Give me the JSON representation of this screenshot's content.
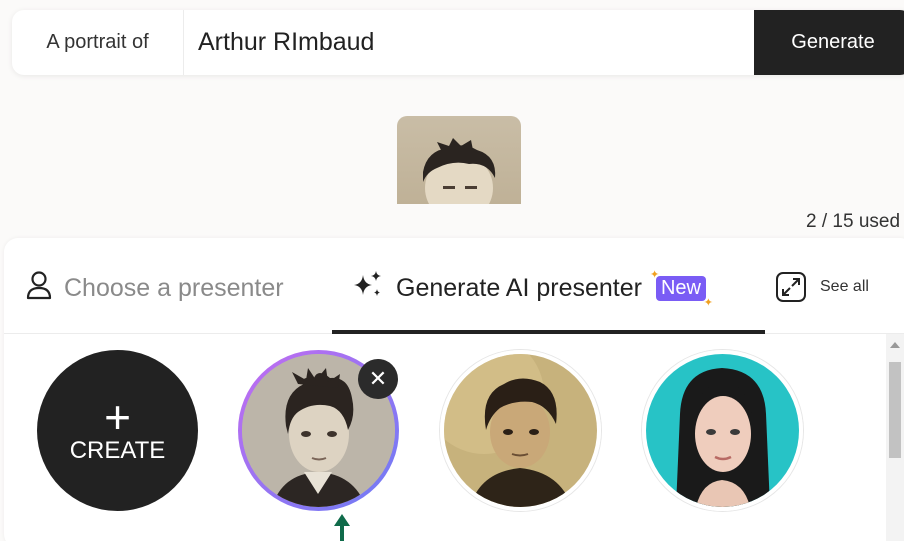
{
  "prompt": {
    "prefix": "A portrait of",
    "value": "Arthur RImbaud",
    "generate_label": "Generate"
  },
  "usage": "2 / 15 used",
  "tabs": {
    "choose_label": "Choose a presenter",
    "generate_label": "Generate AI presenter",
    "new_badge": "New",
    "see_all_label": "See all"
  },
  "create_label": "CREATE",
  "presenters": [
    {
      "name": "rimbaud-sepia",
      "selected": true
    },
    {
      "name": "rimbaud-painted",
      "selected": false
    },
    {
      "name": "woman-teal",
      "selected": false
    }
  ],
  "colors": {
    "dark": "#222222",
    "accent": "#7a5cf5",
    "badge_sparkle": "#f0a020",
    "teal_bg": "#27c3c6"
  },
  "icons": {
    "choose_tab": "person-icon",
    "generate_tab": "sparkles-icon",
    "see_all": "expand-icon",
    "remove": "close-icon"
  }
}
